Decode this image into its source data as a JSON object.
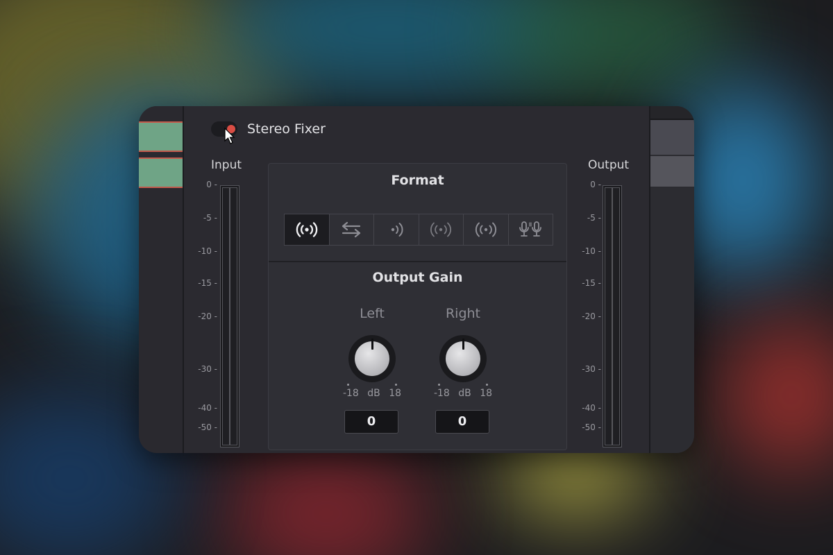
{
  "plugin": {
    "title": "Stereo Fixer",
    "enabled": true
  },
  "input_meter": {
    "label": "Input",
    "ticks": [
      "0",
      "-5",
      "-10",
      "-15",
      "-20",
      "-30",
      "-40",
      "-50"
    ]
  },
  "output_meter": {
    "label": "Output",
    "ticks": [
      "0",
      "-5",
      "-10",
      "-15",
      "-20",
      "-30",
      "-40",
      "-50"
    ]
  },
  "format": {
    "title": "Format",
    "buttons": [
      {
        "icon": "broadcast-icon",
        "active": true
      },
      {
        "icon": "swap-arrows-icon",
        "active": false
      },
      {
        "icon": "right-channel-icon",
        "active": false
      },
      {
        "icon": "broadcast-dim-icon",
        "active": false
      },
      {
        "icon": "broadcast-outline-icon",
        "active": false
      },
      {
        "icon": "dual-mic-icon",
        "active": false
      }
    ]
  },
  "output_gain": {
    "title": "Output Gain",
    "left": {
      "label": "Left",
      "min": "-18",
      "unit": "dB",
      "max": "18",
      "value": "0"
    },
    "right": {
      "label": "Right",
      "min": "-18",
      "unit": "dB",
      "max": "18",
      "value": "0"
    }
  },
  "colors": {
    "toggle_on": "#d94d44",
    "clip_green": "#6fa486",
    "clip_red": "#c35a4c"
  }
}
